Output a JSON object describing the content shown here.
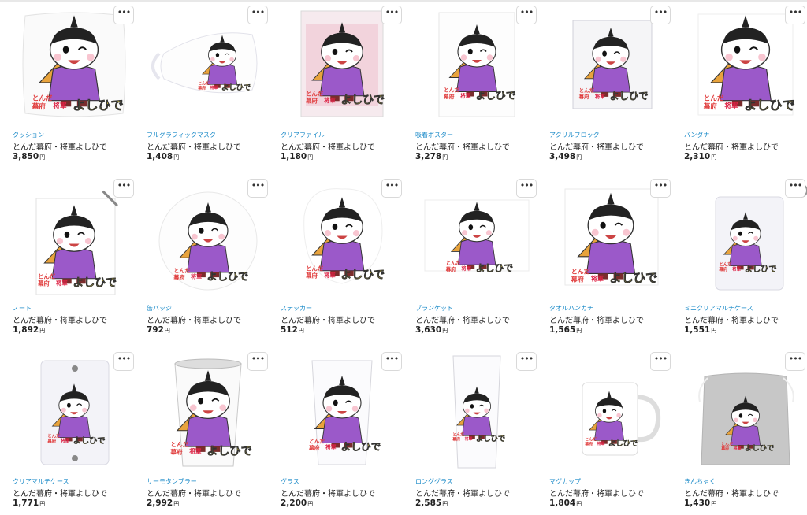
{
  "more_label": "•••",
  "currency": "円",
  "products": [
    {
      "category": "クッション",
      "name": "とんだ幕府・将軍よしひで",
      "price": "3,850",
      "item": "cushion"
    },
    {
      "category": "フルグラフィックマスク",
      "name": "とんだ幕府・将軍よしひで",
      "price": "1,408",
      "item": "mask"
    },
    {
      "category": "クリアファイル",
      "name": "とんだ幕府・将軍よしひで",
      "price": "1,180",
      "item": "clear-file"
    },
    {
      "category": "吸着ポスター",
      "name": "とんだ幕府・将軍よしひで",
      "price": "3,278",
      "item": "poster"
    },
    {
      "category": "アクリルブロック",
      "name": "とんだ幕府・将軍よしひで",
      "price": "3,498",
      "item": "acrylic-block"
    },
    {
      "category": "バンダナ",
      "name": "とんだ幕府・将軍よしひで",
      "price": "2,310",
      "item": "bandana"
    },
    {
      "category": "ノート",
      "name": "とんだ幕府・将軍よしひで",
      "price": "1,892",
      "item": "notebook"
    },
    {
      "category": "缶バッジ",
      "name": "とんだ幕府・将軍よしひで",
      "price": "792",
      "item": "badge"
    },
    {
      "category": "ステッカー",
      "name": "とんだ幕府・将軍よしひで",
      "price": "512",
      "item": "sticker"
    },
    {
      "category": "ブランケット",
      "name": "とんだ幕府・将軍よしひで",
      "price": "3,630",
      "item": "blanket"
    },
    {
      "category": "タオルハンカチ",
      "name": "とんだ幕府・将軍よしひで",
      "price": "1,565",
      "item": "towel"
    },
    {
      "category": "ミニクリアマルチケース",
      "name": "とんだ幕府・将軍よしひで",
      "price": "1,551",
      "item": "mini-case"
    },
    {
      "category": "クリアマルチケース",
      "name": "とんだ幕府・将軍よしひで",
      "price": "1,771",
      "item": "clear-case"
    },
    {
      "category": "サーモタンブラー",
      "name": "とんだ幕府・将軍よしひで",
      "price": "2,992",
      "item": "tumbler"
    },
    {
      "category": "グラス",
      "name": "とんだ幕府・将軍よしひで",
      "price": "2,200",
      "item": "glass"
    },
    {
      "category": "ロンググラス",
      "name": "とんだ幕府・将軍よしひで",
      "price": "2,585",
      "item": "long-glass"
    },
    {
      "category": "マグカップ",
      "name": "とんだ幕府・将軍よしひで",
      "price": "1,804",
      "item": "mug"
    },
    {
      "category": "きんちゃく",
      "name": "とんだ幕府・将軍よしひで",
      "price": "1,430",
      "item": "drawstring-bag"
    }
  ],
  "artwork": {
    "lines": [
      "とんだ",
      "幕府",
      "将軍",
      "よしひで"
    ],
    "colors": {
      "robe": "#9b59c9",
      "fan": "#e8a33c",
      "title_red": "#e03c3c",
      "title_yellow": "#ffe93c"
    }
  }
}
